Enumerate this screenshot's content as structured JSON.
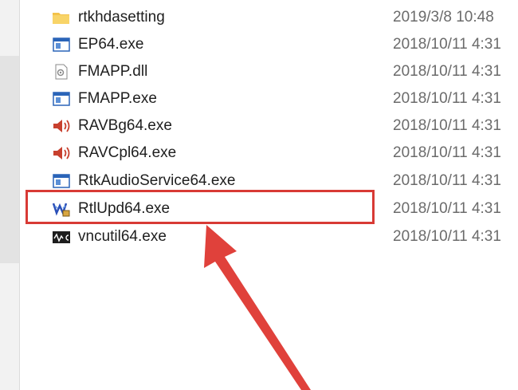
{
  "files": [
    {
      "name": "rtkhdasetting",
      "date": "2019/3/8 10:48",
      "icon": "folder-icon"
    },
    {
      "name": "EP64.exe",
      "date": "2018/10/11 4:31",
      "icon": "exe-window-icon"
    },
    {
      "name": "FMAPP.dll",
      "date": "2018/10/11 4:31",
      "icon": "dll-gear-icon"
    },
    {
      "name": "FMAPP.exe",
      "date": "2018/10/11 4:31",
      "icon": "exe-window-icon"
    },
    {
      "name": "RAVBg64.exe",
      "date": "2018/10/11 4:31",
      "icon": "speaker-icon"
    },
    {
      "name": "RAVCpl64.exe",
      "date": "2018/10/11 4:31",
      "icon": "speaker-icon"
    },
    {
      "name": "RtkAudioService64.exe",
      "date": "2018/10/11 4:31",
      "icon": "exe-window-icon"
    },
    {
      "name": "RtlUpd64.exe",
      "date": "2018/10/11 4:31",
      "icon": "realtek-update-icon"
    },
    {
      "name": "vncutil64.exe",
      "date": "2018/10/11 4:31",
      "icon": "vnc-utility-icon"
    }
  ],
  "annotation": {
    "highlighted_file": "RtlUpd64.exe",
    "highlight_color": "#d83a35",
    "arrow_color": "#e0413b"
  },
  "colors": {
    "folder": "#f3c24a",
    "exe_blue": "#2a64b8",
    "speaker": "#c8402e"
  }
}
